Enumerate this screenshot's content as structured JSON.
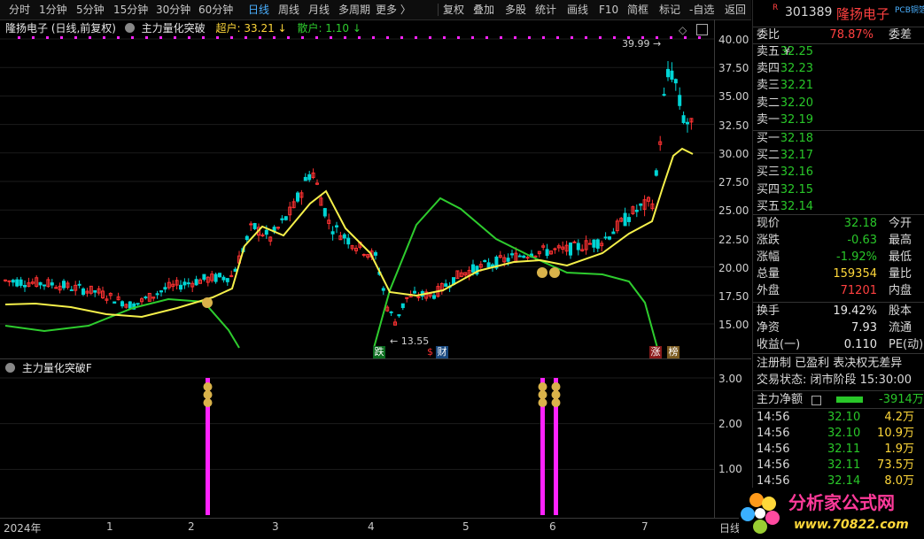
{
  "toolbar": {
    "periods": [
      "分时",
      "1分钟",
      "5分钟",
      "15分钟",
      "30分钟",
      "60分钟",
      "日线",
      "周线",
      "月线",
      "多周期",
      "更多 〉"
    ],
    "active_period": "日线",
    "tools": [
      "复权",
      "叠加",
      "多股",
      "统计",
      "画线",
      "F10",
      "简框",
      "标记",
      "-自选",
      "返回"
    ]
  },
  "main_chart": {
    "stock_title": "隆扬电子 (日线,前复权)",
    "indicator_name": "主力量化突破",
    "super_label": "超户: 33.21",
    "retail_label": "散户: 1.10",
    "high_annotation": "39.99",
    "low_annotation": "13.55",
    "markers": {
      "die": "跌",
      "cai_prefix": "$",
      "cai": "财",
      "zhang": "涨",
      "bang": "榜"
    },
    "y_ticks": [
      "40.00",
      "37.50",
      "35.00",
      "32.50",
      "30.00",
      "27.50",
      "25.00",
      "22.50",
      "20.00",
      "17.50",
      "15.00"
    ],
    "colors": {
      "up": "#ff3232",
      "down": "#00d5d5",
      "ma": "#f5f04a",
      "retail_line": "#2ecc2e",
      "bar": "#ff22ff"
    }
  },
  "sub_chart": {
    "title": "主力量化突破F",
    "y_ticks": [
      "3.00",
      "2.00",
      "1.00"
    ],
    "bar_dates": [
      "2024-02-28",
      "2024-06-03",
      "2024-06-05"
    ]
  },
  "x_axis": {
    "labels": [
      "2024年",
      "1",
      "2",
      "3",
      "4",
      "5",
      "6",
      "7"
    ],
    "right_label": "日线"
  },
  "panel": {
    "r_icon": "R",
    "code": "301389",
    "name": "隆扬电子",
    "tag": "PCB铜箔",
    "weibi_label": "委比",
    "weibi_value": "78.87%",
    "weicha_label": "委差",
    "orders": [
      {
        "label": "卖五 ¥",
        "price": "32.25"
      },
      {
        "label": "卖四",
        "price": "32.23"
      },
      {
        "label": "卖三",
        "price": "32.21"
      },
      {
        "label": "卖二",
        "price": "32.20"
      },
      {
        "label": "卖一",
        "price": "32.19"
      },
      {
        "label": "买一",
        "price": "32.18"
      },
      {
        "label": "买二",
        "price": "32.17"
      },
      {
        "label": "买三",
        "price": "32.16"
      },
      {
        "label": "买四",
        "price": "32.15"
      },
      {
        "label": "买五",
        "price": "32.14"
      }
    ],
    "quote": [
      {
        "k": "现价",
        "v": "32.18",
        "k2": "今开",
        "c": "green"
      },
      {
        "k": "涨跌",
        "v": "-0.63",
        "k2": "最高",
        "c": "green"
      },
      {
        "k": "涨幅",
        "v": "-1.92%",
        "k2": "最低",
        "c": "green"
      },
      {
        "k": "总量",
        "v": "159354",
        "k2": "量比",
        "c": "yellow"
      },
      {
        "k": "外盘",
        "v": "71201",
        "k2": "内盘",
        "c": "red"
      }
    ],
    "stats": [
      {
        "k": "换手",
        "v": "19.42%",
        "k2": "股本"
      },
      {
        "k": "净资",
        "v": "7.93",
        "k2": "流通"
      },
      {
        "k": "收益(一)",
        "v": "0.110",
        "k2": "PE(动)"
      }
    ],
    "reg_line": "注册制 已盈利 表决权无差异",
    "status_line": "交易状态: 闭市阶段 15:30:00",
    "flow_label": "主力净额",
    "flow_value": "-3914万",
    "trades": [
      {
        "t": "14:56",
        "p": "32.10",
        "v": "4.2万"
      },
      {
        "t": "14:56",
        "p": "32.10",
        "v": "10.9万"
      },
      {
        "t": "14:56",
        "p": "32.11",
        "v": "1.9万"
      },
      {
        "t": "14:56",
        "p": "32.11",
        "v": "73.5万"
      },
      {
        "t": "14:56",
        "p": "32.14",
        "v": "8.0万"
      }
    ]
  },
  "logo": {
    "text": "分析家公式网",
    "url": "www.70822.com"
  }
}
